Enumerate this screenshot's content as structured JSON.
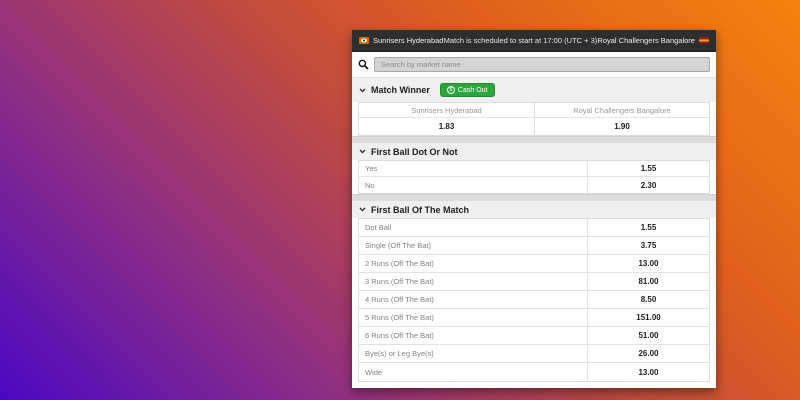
{
  "header": {
    "home_team": "Sunrisers Hyderabad",
    "status": "Match is scheduled to start at 17:00 (UTC + 3)",
    "away_team": "Royal Challengers Bangalore"
  },
  "search": {
    "placeholder": "Search by market name"
  },
  "icons": {
    "cashout_coin": "$"
  },
  "markets": [
    {
      "title": "Match Winner",
      "cashout_label": "Cash Out",
      "columns": [
        {
          "label": "Sunrisers Hyderabad",
          "odds": "1.83"
        },
        {
          "label": "Royal Challengers Bangalore",
          "odds": "1.90"
        }
      ]
    },
    {
      "title": "First Ball Dot Or Not",
      "rows": [
        {
          "label": "Yes",
          "odds": "1.55"
        },
        {
          "label": "No",
          "odds": "2.30"
        }
      ]
    },
    {
      "title": "First Ball Of The Match",
      "rows": [
        {
          "label": "Dot Ball",
          "odds": "1.55"
        },
        {
          "label": "Single (Off The Bat)",
          "odds": "3.75"
        },
        {
          "label": "2 Runs (Off The Bat)",
          "odds": "13.00"
        },
        {
          "label": "3 Runs (Off The Bat)",
          "odds": "81.00"
        },
        {
          "label": "4 Runs (Off The Bat)",
          "odds": "8.50"
        },
        {
          "label": "5 Runs (Off The Bat)",
          "odds": "151.00"
        },
        {
          "label": "6 Runs (Off The Bat)",
          "odds": "51.00"
        },
        {
          "label": "Bye(s) or Leg Bye(s)",
          "odds": "26.00"
        },
        {
          "label": "Wide",
          "odds": "13.00"
        }
      ]
    }
  ],
  "colors": {
    "topbar_bg": "#2e2e2e",
    "cashout_green": "#2ca63c",
    "srh_orange": "#e8640a",
    "rcb_red": "#a01313",
    "rcb_gold": "#d8a62a",
    "search_input_bg": "#d4d4d4",
    "bg_gradient_start": "#f5820e",
    "bg_gradient_end": "#4b08c4"
  }
}
